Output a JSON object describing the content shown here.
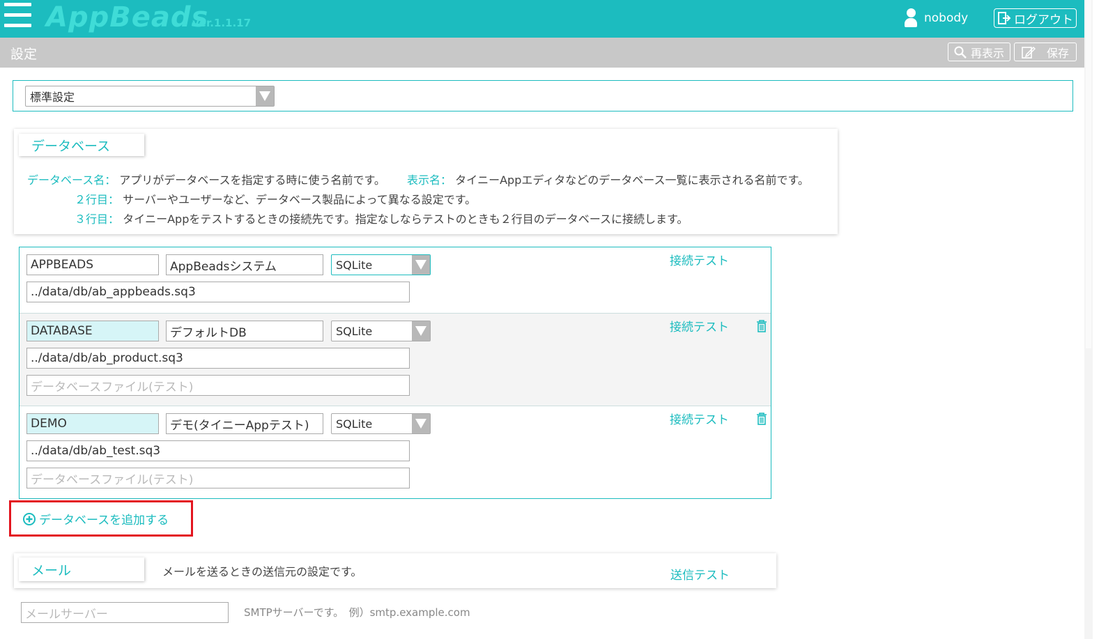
{
  "header": {
    "logo": "AppBeads",
    "version": "ver.1.1.17",
    "username": "nobody",
    "logout_label": "ログアウト"
  },
  "subbar": {
    "title": "設定",
    "refresh_label": "再表示",
    "save_label": "保存"
  },
  "profile_select": {
    "value": "標準設定"
  },
  "database_section": {
    "tab_label": "データベース",
    "desc": {
      "dbname_key": "データベース名：",
      "dbname_text": "アプリがデータベースを指定する時に使う名前です。",
      "display_key": "表示名：",
      "display_text": "タイニーAppエディタなどのデータベース一覧に表示される名前です。",
      "line2_key": "２行目：",
      "line2_text": "サーバーやユーザーなど、データベース製品によって異なる設定です。",
      "line3_key": "３行目：",
      "line3_text": "タイニーAppをテストするときの接続先です。指定なしならテストのときも２行目のデータベースに接続します。"
    },
    "test_label": "接続テスト",
    "test_placeholder": "データベースファイル(テスト)",
    "rows": [
      {
        "name": "APPBEADS",
        "display": "AppBeadsシステム",
        "type": "SQLite",
        "path": "../data/db/ab_appbeads.sq3"
      },
      {
        "name": "DATABASE",
        "display": "デフォルトDB",
        "type": "SQLite",
        "path": "../data/db/ab_product.sq3"
      },
      {
        "name": "DEMO",
        "display": "デモ(タイニーAppテスト)",
        "type": "SQLite",
        "path": "../data/db/ab_test.sq3"
      }
    ],
    "add_label": "データベースを追加する"
  },
  "mail_section": {
    "tab_label": "メール",
    "desc": "メールを送るときの送信元の設定です。",
    "test_label": "送信テスト",
    "server_placeholder": "メールサーバー",
    "server_hint": "SMTPサーバーです。　例）smtp.example.com"
  },
  "colors": {
    "accent": "#1cbcbf",
    "highlight_border": "#e3151f",
    "subbar": "#c8c8c8"
  }
}
